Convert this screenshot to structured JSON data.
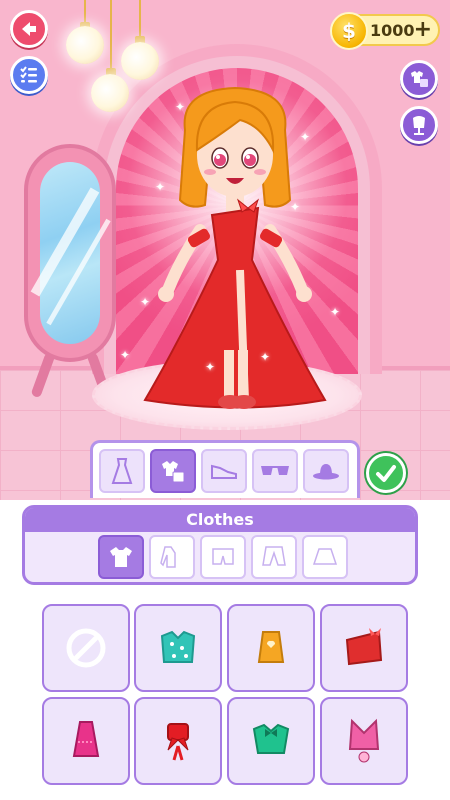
{
  "header": {
    "back_icon": "back-arrow-icon",
    "list_icon": "checklist-icon",
    "coins": {
      "symbol": "$",
      "value": "1000",
      "plus": "+"
    },
    "side_buttons": [
      {
        "name": "outfit-icon"
      },
      {
        "name": "mannequin-icon"
      }
    ]
  },
  "scene": {
    "character": {
      "hair_color": "#f59a1c",
      "dress_color": "#e32a2a"
    }
  },
  "category_bar": {
    "tabs": [
      {
        "name": "dress-tab",
        "icon": "dress-icon",
        "active": false
      },
      {
        "name": "clothes-tab",
        "icon": "clothes-icon",
        "active": true
      },
      {
        "name": "shoes-tab",
        "icon": "sneaker-icon",
        "active": false
      },
      {
        "name": "glasses-tab",
        "icon": "sunglasses-icon",
        "active": false
      },
      {
        "name": "hat-tab",
        "icon": "hat-icon",
        "active": false
      }
    ],
    "confirm_icon": "checkmark-icon"
  },
  "panel": {
    "title": "Clothes",
    "sub_tabs": [
      {
        "name": "tshirt-tab",
        "icon": "tshirt-icon",
        "active": true
      },
      {
        "name": "long-sleeve-tab",
        "icon": "long-sleeve-icon",
        "active": false
      },
      {
        "name": "shorts-tab",
        "icon": "shorts-icon",
        "active": false
      },
      {
        "name": "pants-tab",
        "icon": "pants-icon",
        "active": false
      },
      {
        "name": "skirt-tab",
        "icon": "skirt-icon",
        "active": false
      }
    ]
  },
  "items": [
    {
      "name": "none-item",
      "icon": "no-symbol-icon",
      "color": "#ffffff"
    },
    {
      "name": "teal-polka-top",
      "icon": "top-icon",
      "color": "#32c4b7"
    },
    {
      "name": "orange-heart-top",
      "icon": "top-icon",
      "color": "#f5a623"
    },
    {
      "name": "red-butterfly-top",
      "icon": "top-icon",
      "color": "#e02e2e"
    },
    {
      "name": "pink-halter-top",
      "icon": "top-icon",
      "color": "#e8338a"
    },
    {
      "name": "red-bow-top",
      "icon": "top-icon",
      "color": "#e31d24"
    },
    {
      "name": "green-bow-top",
      "icon": "top-icon",
      "color": "#1fc28e"
    },
    {
      "name": "pink-flower-top",
      "icon": "top-icon",
      "color": "#f060a6"
    }
  ],
  "colors": {
    "accent": "#a57be3",
    "accent_dark": "#8b5cd6",
    "scene_pink": "#f9b6cd",
    "confirm_green": "#3fc25b",
    "back_red": "#ee4c6d",
    "list_blue": "#5b7cf0"
  }
}
